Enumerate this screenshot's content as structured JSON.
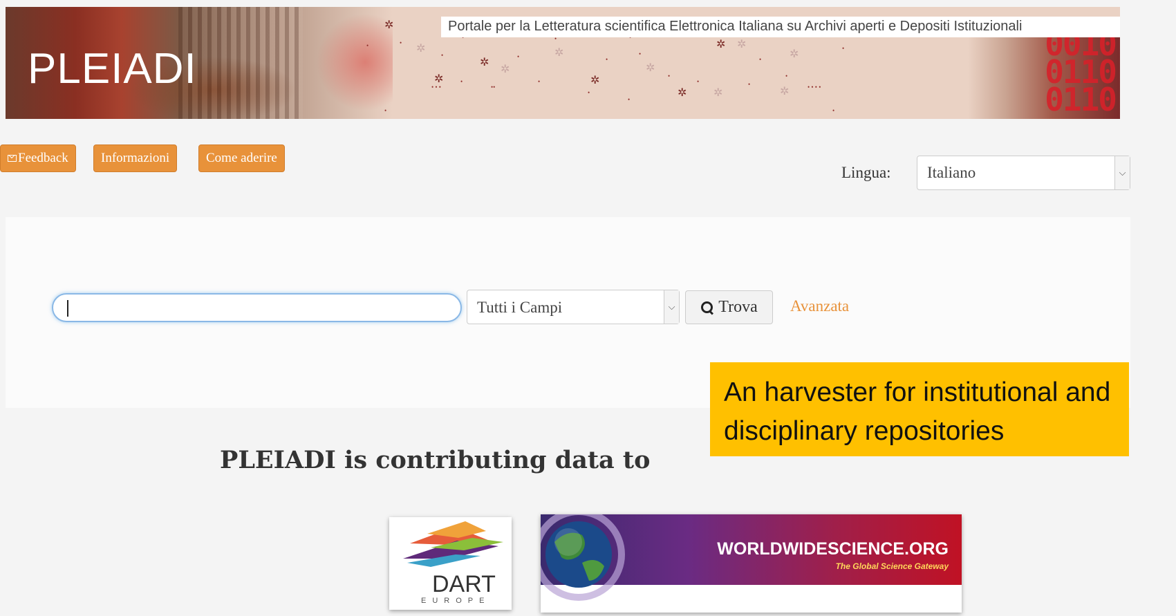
{
  "header": {
    "logo_text": "PLEIADI",
    "subtitle": "Portale per la Letteratura scientifica Elettronica Italiana su Archivi aperti e Depositi Istituzionali"
  },
  "nav": {
    "feedback_label": "Feedback",
    "informazioni_label": "Informazioni",
    "come_aderire_label": "Come aderire"
  },
  "language": {
    "label": "Lingua:",
    "selected": "Italiano"
  },
  "search": {
    "query_value": "",
    "field_selected": "Tutti i Campi",
    "submit_label": "Trova",
    "advanced_label": "Avanzata"
  },
  "callout": {
    "text": "An harvester for institutional and disciplinary repositories"
  },
  "contributing": {
    "heading": "PLEIADI is contributing data to",
    "partners": [
      {
        "name": "DART",
        "sub": "EUROPE"
      },
      {
        "name": "WORLDWIDESCIENCE.ORG",
        "sub": "The Global Science Gateway"
      }
    ]
  },
  "colors": {
    "accent_orange": "#e8923a",
    "callout_yellow": "#ffc000",
    "focus_blue": "#8ab8e6"
  }
}
